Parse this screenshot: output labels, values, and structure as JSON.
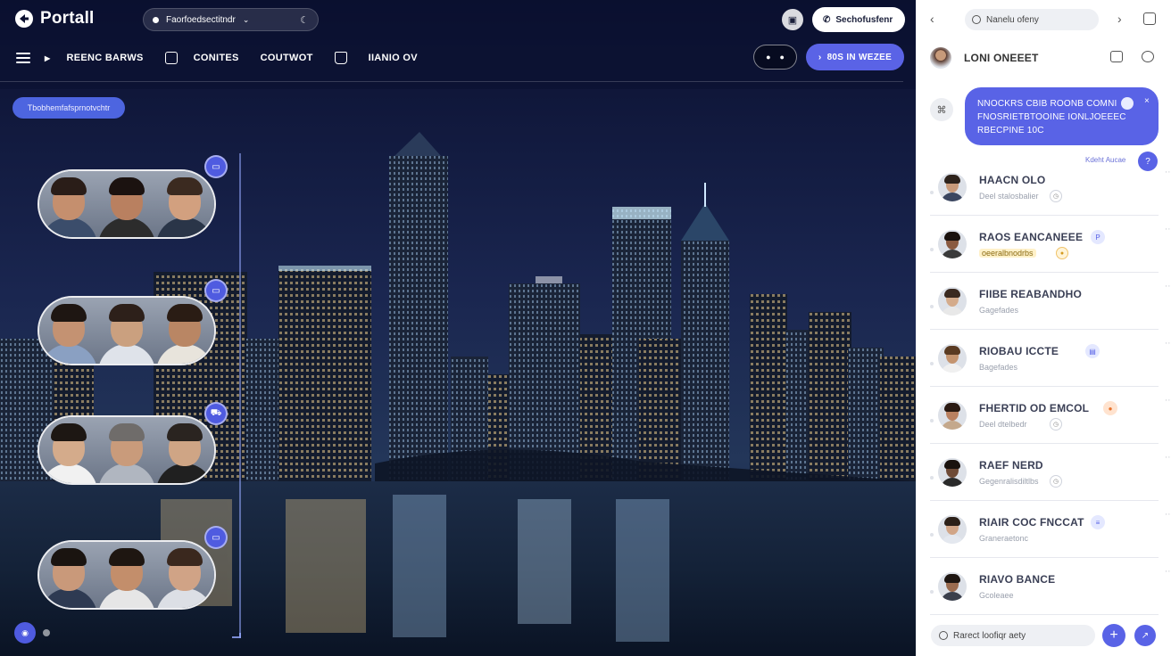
{
  "app": {
    "name": "Portall"
  },
  "topbar": {
    "workspace_select": "Faorfoedsectitndr",
    "workspace_chevron": "⌄",
    "spinner": "☾",
    "camera_btn": "▣",
    "search_label": "Sechofusfenr",
    "search_icon": "phone-icon"
  },
  "nav": {
    "items": [
      {
        "label": "REENC BARWS"
      },
      {
        "label": "CONITES"
      },
      {
        "label": "COUTWOT"
      },
      {
        "label": "IIANIO OV"
      }
    ],
    "toggle_left": "●",
    "toggle_right": "●",
    "cta_label": "80S IN WEZEE",
    "cta_arrow": "›"
  },
  "filter_chip": "Tbobhemfafsprnotvchtr",
  "groups": [
    {
      "badge": "▭",
      "faces": [
        {
          "skin": "#c58f6e",
          "hair": "#2a1d18",
          "shirt": "#3b4d6b"
        },
        {
          "skin": "#b98060",
          "hair": "#1b1210",
          "shirt": "#2c2c2c"
        },
        {
          "skin": "#d2a07f",
          "hair": "#3b2a20",
          "shirt": "#2a3548"
        }
      ]
    },
    {
      "badge": "▭",
      "faces": [
        {
          "skin": "#c49272",
          "hair": "#1e1612",
          "shirt": "#8aa0c2"
        },
        {
          "skin": "#caa07f",
          "hair": "#2d201a",
          "shirt": "#dfe3ea"
        },
        {
          "skin": "#b98664",
          "hair": "#2a1c14",
          "shirt": "#e8e4dc"
        }
      ]
    },
    {
      "badge": "⛟",
      "faces": [
        {
          "skin": "#d4ab8b",
          "hair": "#1d1713",
          "shirt": "#f1f1f1"
        },
        {
          "skin": "#c99b7b",
          "hair": "#6f6c6a",
          "shirt": "#b0b6c0"
        },
        {
          "skin": "#cfa585",
          "hair": "#2a2420",
          "shirt": "#202020"
        }
      ]
    },
    {
      "badge": "▭",
      "faces": [
        {
          "skin": "#c9997a",
          "hair": "#1a1410",
          "shirt": "#2e3a52"
        },
        {
          "skin": "#c38e6b",
          "hair": "#1e1611",
          "shirt": "#e6e6e6"
        },
        {
          "skin": "#d0a386",
          "hair": "#3a281e",
          "shirt": "#dcdfe5"
        }
      ]
    }
  ],
  "bottom_left": {
    "btn": "◉"
  },
  "panel": {
    "search_placeholder": "Nanelu ofeny",
    "nav_back": "‹",
    "nav_forward": "›",
    "header_title": "LONI ONEEET",
    "bubble": {
      "lines": [
        "NNOCKRS CBIB ROONB COMNI",
        "FNOSRIETBTOOINE IONLJOEEEC",
        "RBECPINE 10C"
      ],
      "close": "×"
    },
    "bubble_icon": "⌘",
    "seen_text": "Kdeht Aucae",
    "seen_btn": "?",
    "contacts": [
      {
        "name": "HAACN OLO",
        "sub": "Deel stalosbalier",
        "tag": "",
        "subtag": "◷",
        "highlight": false,
        "skin": "#c99a7a",
        "hair": "#2e231c",
        "shirt": "#3b4660"
      },
      {
        "name": "RAOS EANCANEEE",
        "sub": "oeeralbnodrbs",
        "tag": "P",
        "subtag": "●",
        "highlight": true,
        "skin": "#8a5a40",
        "hair": "#1a120e",
        "shirt": "#3a3a3a"
      },
      {
        "name": "FIIBE REABANDHO",
        "sub": "Gagefades",
        "tag": "",
        "subtag": "",
        "highlight": false,
        "skin": "#d4ab8b",
        "hair": "#3b2a20",
        "shirt": "#e8e8e8"
      },
      {
        "name": "RIOBAU ICCTE",
        "sub": "Bagefades",
        "tag": "▤",
        "subtag": "",
        "highlight": false,
        "skin": "#c4946f",
        "hair": "#5a3b22",
        "shirt": "#f0f0f0"
      },
      {
        "name": "FHERTID OD EMCOL",
        "sub": "Deel dtelbedr",
        "tag": "●",
        "subtag": "◷",
        "highlight": false,
        "skin": "#b98060",
        "hair": "#2a1a12",
        "shirt": "#c4a88c"
      },
      {
        "name": "RAEF NERD",
        "sub": "Gegenralisdiltlbs",
        "tag": "",
        "subtag": "◷",
        "highlight": false,
        "skin": "#6e4a36",
        "hair": "#1a120e",
        "shirt": "#2a2a2a"
      },
      {
        "name": "RIAIR COC FNCCAT",
        "sub": "Graneraetonc",
        "tag": "≡",
        "subtag": "",
        "highlight": false,
        "skin": "#d1a587",
        "hair": "#2c2018",
        "shirt": "#e4e8ef"
      },
      {
        "name": "RIAVO BANCE",
        "sub": "Gcoleaee",
        "tag": "",
        "subtag": "",
        "highlight": false,
        "skin": "#9a6b4f",
        "hair": "#1e1611",
        "shirt": "#3a3f4c"
      }
    ],
    "more_glyph": "∙∙",
    "input_placeholder": "Rarect loofiqr aety",
    "add_btn": "+",
    "send_btn": "↗"
  }
}
